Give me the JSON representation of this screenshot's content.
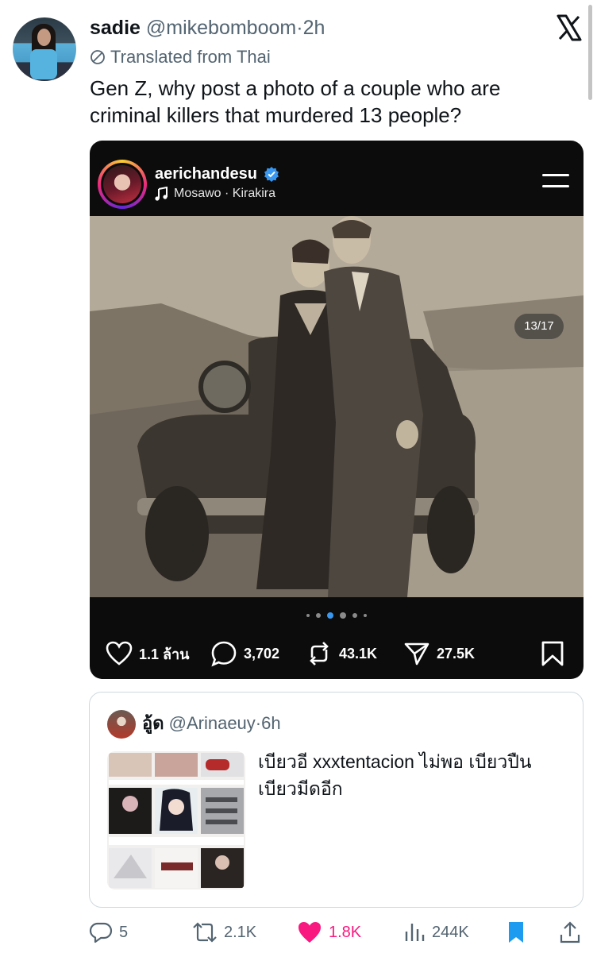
{
  "tweet": {
    "author_name": "sadie",
    "author_handle": "@mikebomboom",
    "separator": "·",
    "time": "2h",
    "translated_label": "Translated from Thai",
    "text": "Gen Z, why post a photo of a couple who are criminal killers that murdered 13 people?"
  },
  "embed": {
    "username": "aerichandesu",
    "music": "Mosawo · Kirakira",
    "counter": "13/17",
    "likes": "1.1 ล้าน",
    "comments": "3,702",
    "reposts": "43.1K",
    "shares": "27.5K",
    "carousel_active_index": 2,
    "carousel_count": 6
  },
  "quote": {
    "author_name": "อู้ด",
    "author_handle": "@Arinaeuy",
    "separator": "·",
    "time": "6h",
    "text": "เบียวอี xxxtentacion ไม่พอ เบียวปืนเบียวมีดอีก"
  },
  "actions": {
    "replies": "5",
    "retweets": "2.1K",
    "likes": "1.8K",
    "views": "244K"
  },
  "colors": {
    "like_pink": "#f91880",
    "x_blue": "#1d9bf0",
    "secondary_text": "#536471"
  }
}
